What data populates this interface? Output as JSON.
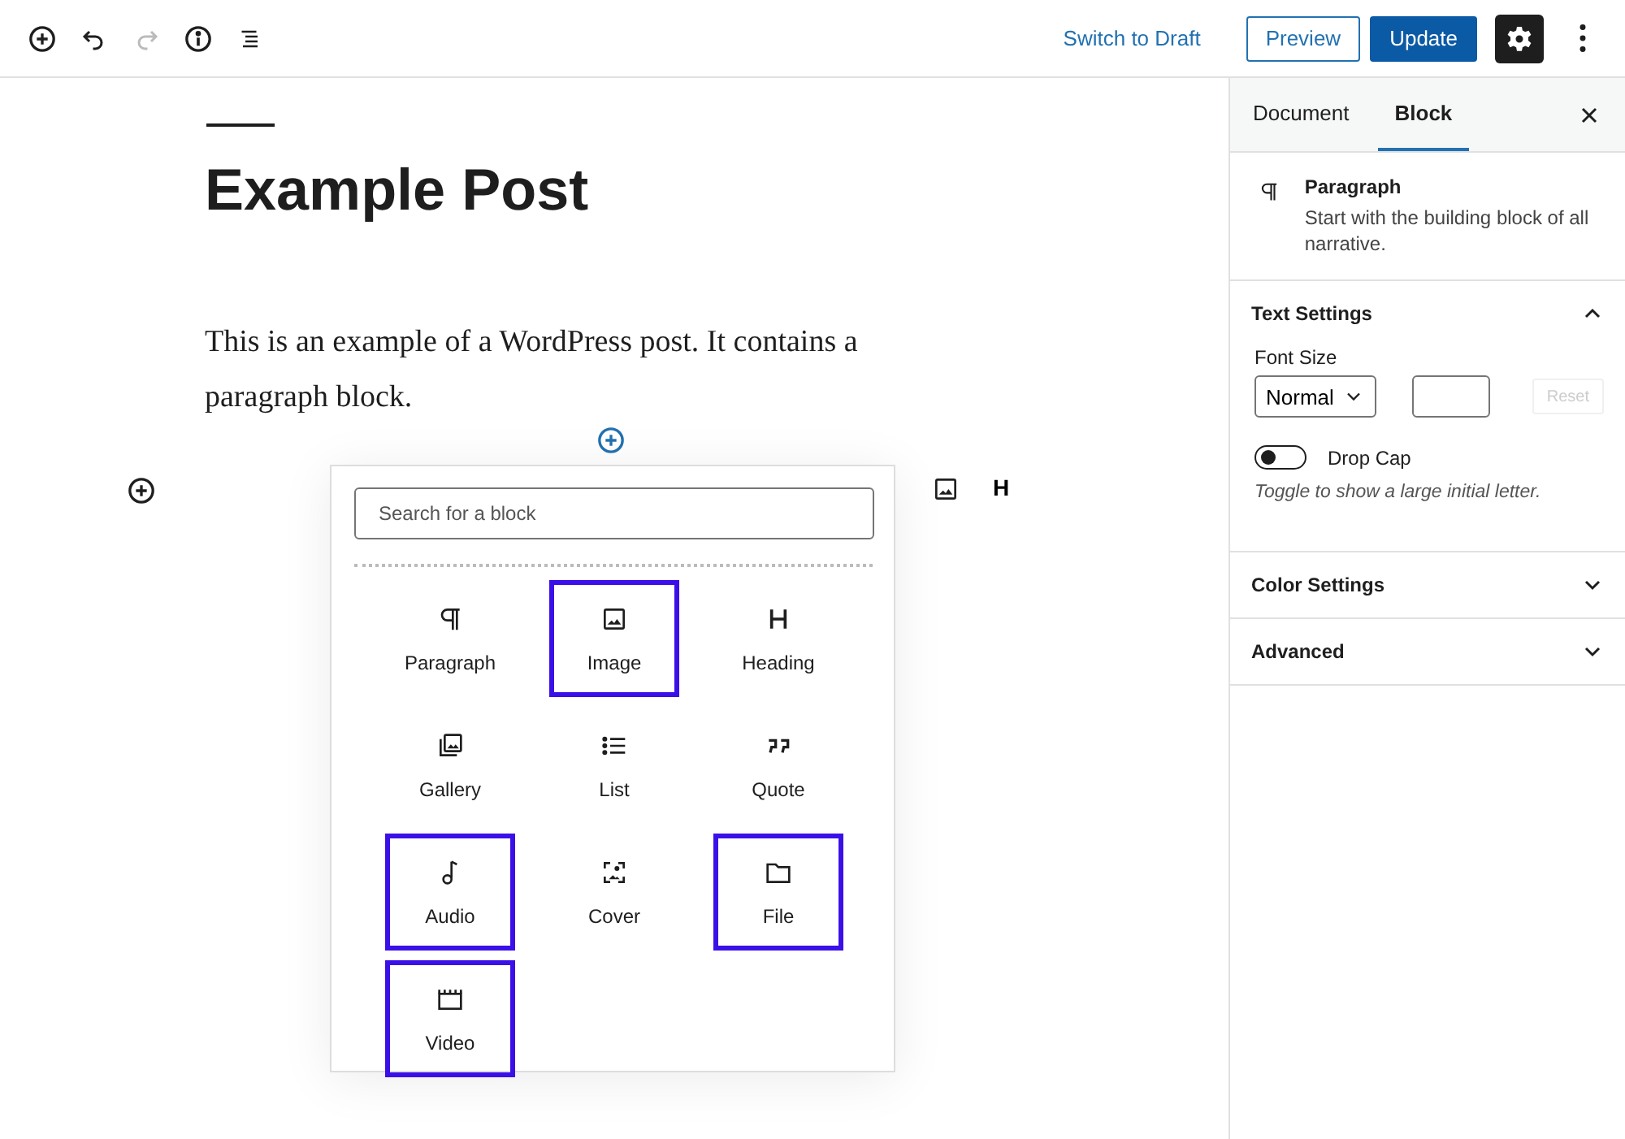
{
  "header": {
    "switch_link": "Switch to Draft",
    "preview_button": "Preview",
    "update_button": "Update",
    "settings_active": true
  },
  "post": {
    "title": "Example Post",
    "paragraph": "This is an example of a WordPress post. It contains a paragraph block.",
    "toolbar_heading": "H"
  },
  "inserter": {
    "search": {
      "placeholder": "Search for a block"
    },
    "blocks": [
      {
        "label": "Paragraph",
        "highlighted": false
      },
      {
        "label": "Image",
        "highlighted": true
      },
      {
        "label": "Heading",
        "highlighted": false
      },
      {
        "label": "Gallery",
        "highlighted": false
      },
      {
        "label": "List",
        "highlighted": false
      },
      {
        "label": "Quote",
        "highlighted": false
      },
      {
        "label": "Audio",
        "highlighted": true
      },
      {
        "label": "Cover",
        "highlighted": false
      },
      {
        "label": "File",
        "highlighted": true
      },
      {
        "label": "Video",
        "highlighted": true
      }
    ]
  },
  "sidebar": {
    "tabs": [
      {
        "label": "Document",
        "selected": false
      },
      {
        "label": "Block",
        "selected": true
      }
    ],
    "block_card": {
      "title": "Paragraph",
      "description": "Start with the building block of all narrative."
    },
    "panels": [
      {
        "title": "Text Settings",
        "expanded": true
      },
      {
        "title": "Color Settings",
        "expanded": false
      },
      {
        "title": "Advanced",
        "expanded": false
      }
    ],
    "text_settings": {
      "font_size_label": "Font Size",
      "font_size_value": "Normal",
      "reset_button": "Reset",
      "reset_disabled": true,
      "drop_cap": {
        "label": "Drop Cap",
        "on": false
      },
      "help": "Toggle to show a large initial letter."
    }
  }
}
